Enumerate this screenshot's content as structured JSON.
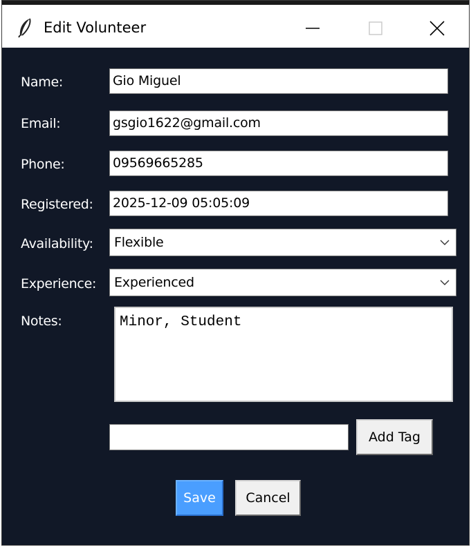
{
  "window": {
    "title": "Edit Volunteer",
    "icons": {
      "app": "feather-icon",
      "minimize": "minimize-icon",
      "maximize": "maximize-icon",
      "close": "close-icon"
    }
  },
  "form": {
    "name": {
      "label": "Name:",
      "value": "Gio Miguel"
    },
    "email": {
      "label": "Email:",
      "value": "gsgio1622@gmail.com"
    },
    "phone": {
      "label": "Phone:",
      "value": "09569665285"
    },
    "registered": {
      "label": "Registered:",
      "value": "2025-12-09 05:05:09"
    },
    "availability": {
      "label": "Availability:",
      "selected": "Flexible"
    },
    "experience": {
      "label": "Experience:",
      "selected": "Experienced"
    },
    "notes": {
      "label": "Notes:",
      "value": "Minor, Student"
    },
    "tag_input": {
      "value": ""
    }
  },
  "buttons": {
    "add_tag": "Add Tag",
    "save": "Save",
    "cancel": "Cancel"
  },
  "colors": {
    "background": "#111827",
    "save_button": "#4a9eff"
  }
}
